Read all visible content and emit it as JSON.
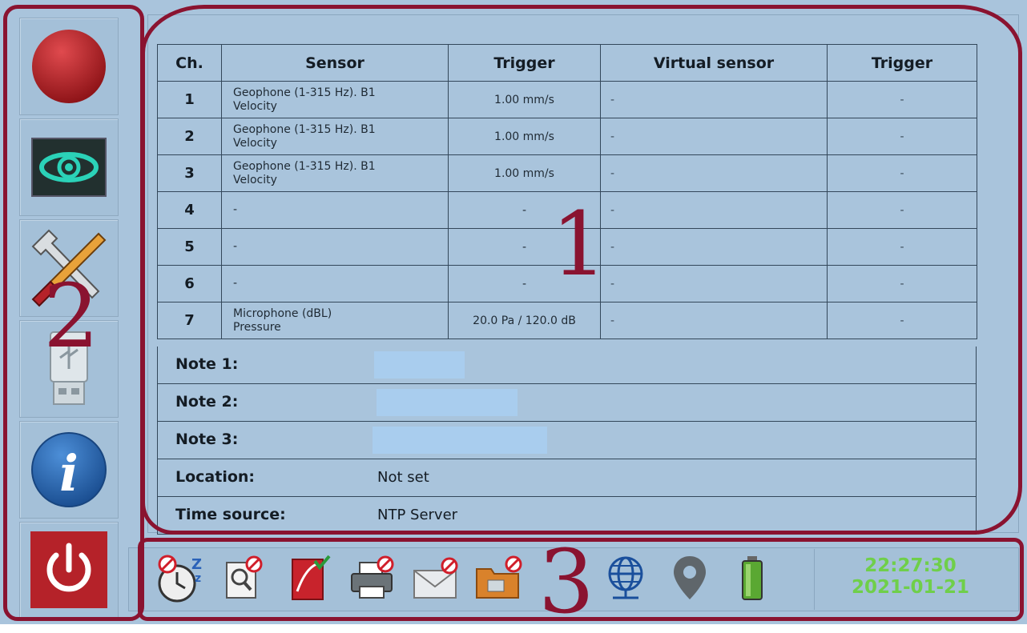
{
  "table": {
    "headers": [
      "Ch.",
      "Sensor",
      "Trigger",
      "Virtual sensor",
      "Trigger"
    ],
    "rows": [
      {
        "ch": "1",
        "sensor_line1": "Geophone (1-315 Hz). B1",
        "sensor_line2": "Velocity",
        "trigger": "1.00 mm/s",
        "virtual": "-",
        "virtual_trigger": "-"
      },
      {
        "ch": "2",
        "sensor_line1": "Geophone (1-315 Hz). B1",
        "sensor_line2": "Velocity",
        "trigger": "1.00 mm/s",
        "virtual": "-",
        "virtual_trigger": "-"
      },
      {
        "ch": "3",
        "sensor_line1": "Geophone (1-315 Hz). B1",
        "sensor_line2": "Velocity",
        "trigger": "1.00 mm/s",
        "virtual": "-",
        "virtual_trigger": "-"
      },
      {
        "ch": "4",
        "sensor_line1": "-",
        "sensor_line2": "",
        "trigger": "-",
        "virtual": "-",
        "virtual_trigger": "-"
      },
      {
        "ch": "5",
        "sensor_line1": "-",
        "sensor_line2": "",
        "trigger": "-",
        "virtual": "-",
        "virtual_trigger": "-"
      },
      {
        "ch": "6",
        "sensor_line1": "-",
        "sensor_line2": "",
        "trigger": "-",
        "virtual": "-",
        "virtual_trigger": "-"
      },
      {
        "ch": "7",
        "sensor_line1": "Microphone (dBL)",
        "sensor_line2": "Pressure",
        "trigger": "20.0 Pa / 120.0 dB",
        "virtual": "-",
        "virtual_trigger": "-"
      }
    ]
  },
  "info": {
    "note1_label": "Note 1:",
    "note2_label": "Note 2:",
    "note3_label": "Note 3:",
    "location_label": "Location:",
    "location_value": "Not set",
    "time_source_label": "Time source:",
    "time_source_value": "NTP Server"
  },
  "sidebar": {
    "items": [
      "record-icon",
      "monitor-eye-icon",
      "tools-icon",
      "usb-drive-icon",
      "info-icon",
      "power-icon"
    ]
  },
  "statusbar": {
    "icons": [
      "sleep-clock-icon",
      "search-disabled-icon",
      "report-icon",
      "printer-disabled-icon",
      "email-disabled-icon",
      "folder-disabled-icon",
      "network-globe-icon",
      "location-pin-icon",
      "battery-icon"
    ],
    "time": "22:27:30",
    "date": "2021-01-21"
  },
  "annotations": {
    "main_number": "1",
    "sidebar_number": "2",
    "statusbar_number": "3",
    "color": "#8a1330"
  },
  "colors": {
    "background": "#a9c4dc",
    "clock": "#6fcf4a",
    "record": "#c0272d",
    "power": "#b52229"
  }
}
